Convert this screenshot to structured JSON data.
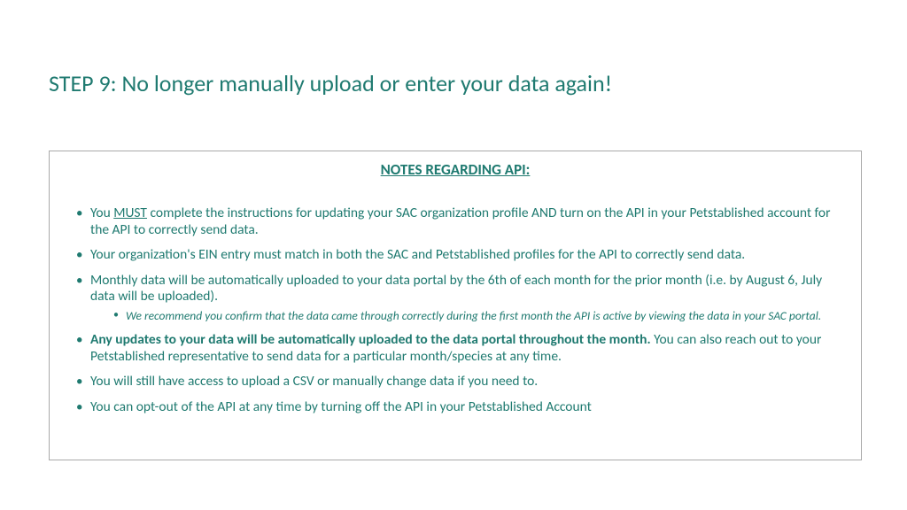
{
  "title": "STEP 9: No longer manually upload or enter your data again!",
  "notes_heading": "NOTES REGARDING API:",
  "bullets": {
    "b1_pre": "You ",
    "b1_must": "MUST",
    "b1_post": " complete the instructions for updating your SAC organization profile AND turn on the API in your Petstablished account for the API to correctly send data.",
    "b2": "Your organization's EIN entry must match in both the SAC and Petstablished profiles for the API to correctly send data.",
    "b3": "Monthly data will be automatically uploaded to your data portal by the 6th of each month for the prior month (i.e. by August 6, July data will be uploaded).",
    "b3_sub": "We recommend you confirm that the data came through correctly during the first month the API is active by viewing the data in your SAC portal.",
    "b4_bold": "Any updates to your data will be automatically uploaded to the data portal throughout the month.",
    "b4_rest": " You can also reach out to your Petstablished representative to send data for a particular month/species at any time.",
    "b5": "You will still have access to upload a CSV or manually change data if you need to.",
    "b6": "You can opt-out of the API at any time by turning off the API in your Petstablished Account"
  }
}
